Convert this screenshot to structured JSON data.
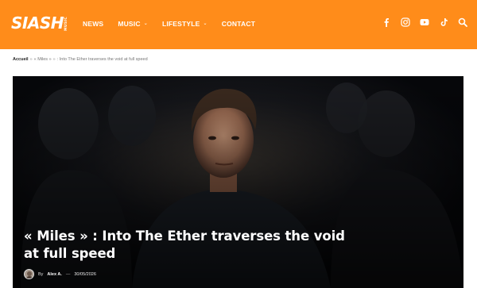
{
  "header": {
    "logo_text": "SIASH",
    "logo_sub": "MUSIC",
    "nav": [
      {
        "label": "NEWS",
        "has_dropdown": false
      },
      {
        "label": "MUSIC",
        "has_dropdown": true
      },
      {
        "label": "LIFESTYLE",
        "has_dropdown": true
      },
      {
        "label": "CONTACT",
        "has_dropdown": false
      }
    ],
    "social_icons": [
      "facebook-icon",
      "instagram-icon",
      "youtube-icon",
      "tiktok-icon",
      "search-icon"
    ],
    "background": "#ff8c1a"
  },
  "breadcrumb": {
    "home": "Accueil",
    "separator": "»",
    "middle": "« Miles »",
    "current": ": Into The Ether traverses the void at full speed"
  },
  "article": {
    "title": "« Miles » : Into The Ether traverses the void at full speed",
    "by_label": "By",
    "author": "Alex A.",
    "dash": "—",
    "date": "30/05/2026"
  }
}
